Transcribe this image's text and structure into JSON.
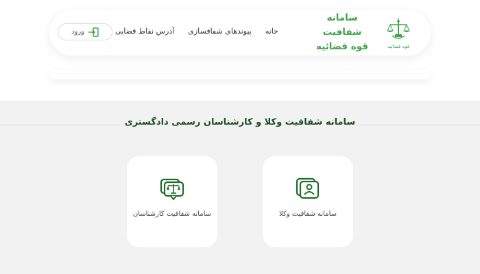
{
  "header": {
    "brand_lines": [
      "سامانه",
      "شفافیت",
      "قوه قضائیه"
    ],
    "emblem_caption": "قوه قضائیه",
    "nav": [
      "خانه",
      "پیوندهای شفافسازی",
      "آدرس نقاط قضایی"
    ],
    "login_label": "ورود"
  },
  "main": {
    "title": "سامانه شفافیت وکلا و کارشناسان رسمی دادگستری",
    "cards": [
      {
        "label": "سامانه شفافیت وکلا",
        "icon": "lawyer-id-icon"
      },
      {
        "label": "سامانه شفافیت کارشناسان",
        "icon": "justice-scale-icon"
      }
    ]
  },
  "colors": {
    "brand_green": "#3fa34a",
    "dark_green": "#1e4d23",
    "background_grey": "#f2f2f2"
  }
}
